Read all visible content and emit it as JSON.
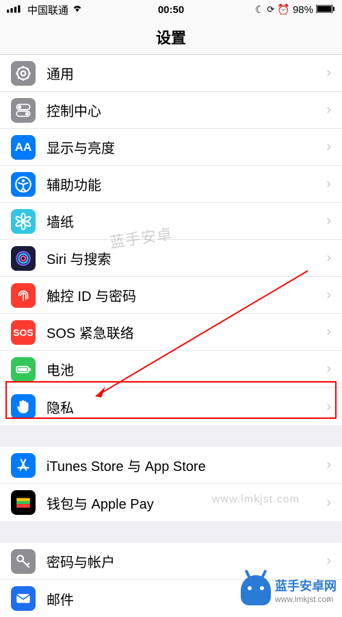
{
  "status": {
    "carrier": "中国联通",
    "time": "00:50",
    "battery": "98%"
  },
  "nav": {
    "title": "设置"
  },
  "groups": [
    {
      "items": [
        {
          "id": "general",
          "label": "通用",
          "icon": "gear",
          "bg": "#8e8e93"
        },
        {
          "id": "control",
          "label": "控制中心",
          "icon": "toggles",
          "bg": "#8e8e93"
        },
        {
          "id": "display",
          "label": "显示与亮度",
          "icon": "aa",
          "bg": "#007aff"
        },
        {
          "id": "accessibility",
          "label": "辅助功能",
          "icon": "accessibility",
          "bg": "#007aff"
        },
        {
          "id": "wallpaper",
          "label": "墙纸",
          "icon": "flower",
          "bg": "#33c5e3"
        },
        {
          "id": "siri",
          "label": "Siri 与搜索",
          "icon": "siri",
          "bg": "#1b1b3a"
        },
        {
          "id": "touchid",
          "label": "触控 ID 与密码",
          "icon": "fingerprint",
          "bg": "#ff3b30"
        },
        {
          "id": "sos",
          "label": "SOS 紧急联络",
          "icon": "sos",
          "bg": "#ff3b30"
        },
        {
          "id": "battery",
          "label": "电池",
          "icon": "battery",
          "bg": "#34c759"
        },
        {
          "id": "privacy",
          "label": "隐私",
          "icon": "hand",
          "bg": "#007aff",
          "highlighted": true
        }
      ]
    },
    {
      "items": [
        {
          "id": "itunes",
          "label": "iTunes Store 与 App Store",
          "icon": "appstore",
          "bg": "#007aff"
        },
        {
          "id": "wallet",
          "label": "钱包与 Apple Pay",
          "icon": "wallet",
          "bg": "#000000"
        }
      ]
    },
    {
      "items": [
        {
          "id": "accounts",
          "label": "密码与帐户",
          "icon": "key",
          "bg": "#8e8e93"
        },
        {
          "id": "mail",
          "label": "邮件",
          "icon": "mail",
          "bg": "#1e6ef0"
        }
      ]
    }
  ],
  "watermark": {
    "text": "蓝手安卓",
    "url": "www.lmkjst.com"
  },
  "brand": {
    "name": "蓝手安卓网",
    "url": "www.lmkjst.com"
  }
}
